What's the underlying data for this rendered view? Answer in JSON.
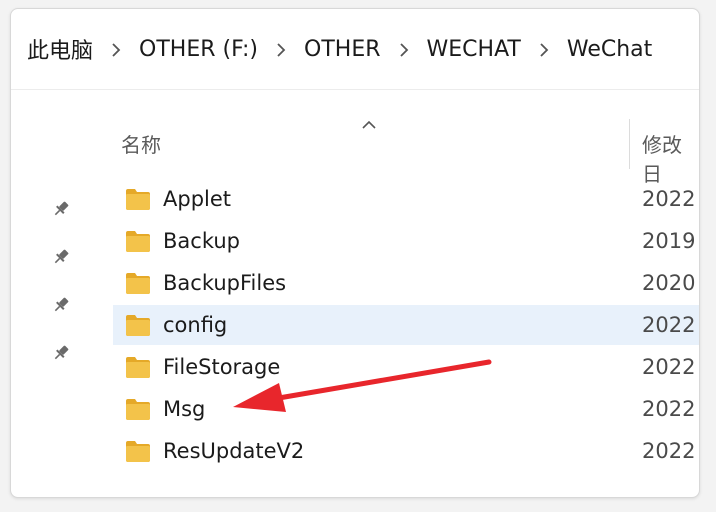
{
  "breadcrumb": {
    "items": [
      "此电脑",
      "OTHER (F:)",
      "OTHER",
      "WECHAT",
      "WeChat"
    ]
  },
  "columns": {
    "name": "名称",
    "date": "修改日"
  },
  "files": [
    {
      "name": "Applet",
      "date": "2022"
    },
    {
      "name": "Backup",
      "date": "2019"
    },
    {
      "name": "BackupFiles",
      "date": "2020"
    },
    {
      "name": "config",
      "date": "2022",
      "selected": true
    },
    {
      "name": "FileStorage",
      "date": "2022"
    },
    {
      "name": "Msg",
      "date": "2022",
      "highlighted": true
    },
    {
      "name": "ResUpdateV2",
      "date": "2022"
    }
  ],
  "colors": {
    "folder": "#f3c34a",
    "folderDark": "#e5a928",
    "selection": "#e8f1fb",
    "annotationArrow": "#e8262c"
  }
}
